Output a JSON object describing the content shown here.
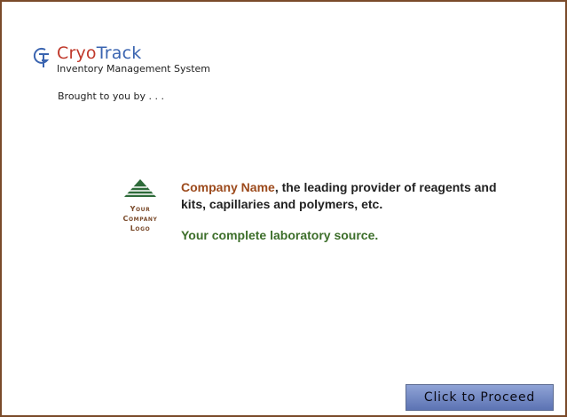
{
  "brand": {
    "name_part1": "Cryo",
    "name_part2": "Track",
    "subtitle": "Inventory Management System",
    "icon": "cryotrack-logo-icon"
  },
  "intro": {
    "brought_text": "Brought to you by . . ."
  },
  "company_logo": {
    "icon": "company-logo-icon",
    "line1": "Your",
    "line2": "Company",
    "line3": "Logo"
  },
  "company": {
    "name": "Company Name",
    "description": ", the leading provider of reagents and kits, capillaries and polymers, etc.",
    "tagline": "Your complete laboratory source."
  },
  "actions": {
    "proceed_label": "Click to Proceed"
  },
  "colors": {
    "border": "#7a4a2a",
    "brand_blue": "#3a64b0",
    "company_brown": "#9c4a1c",
    "tagline_green": "#3c6e2a",
    "button_blue": "#6f86c4"
  }
}
